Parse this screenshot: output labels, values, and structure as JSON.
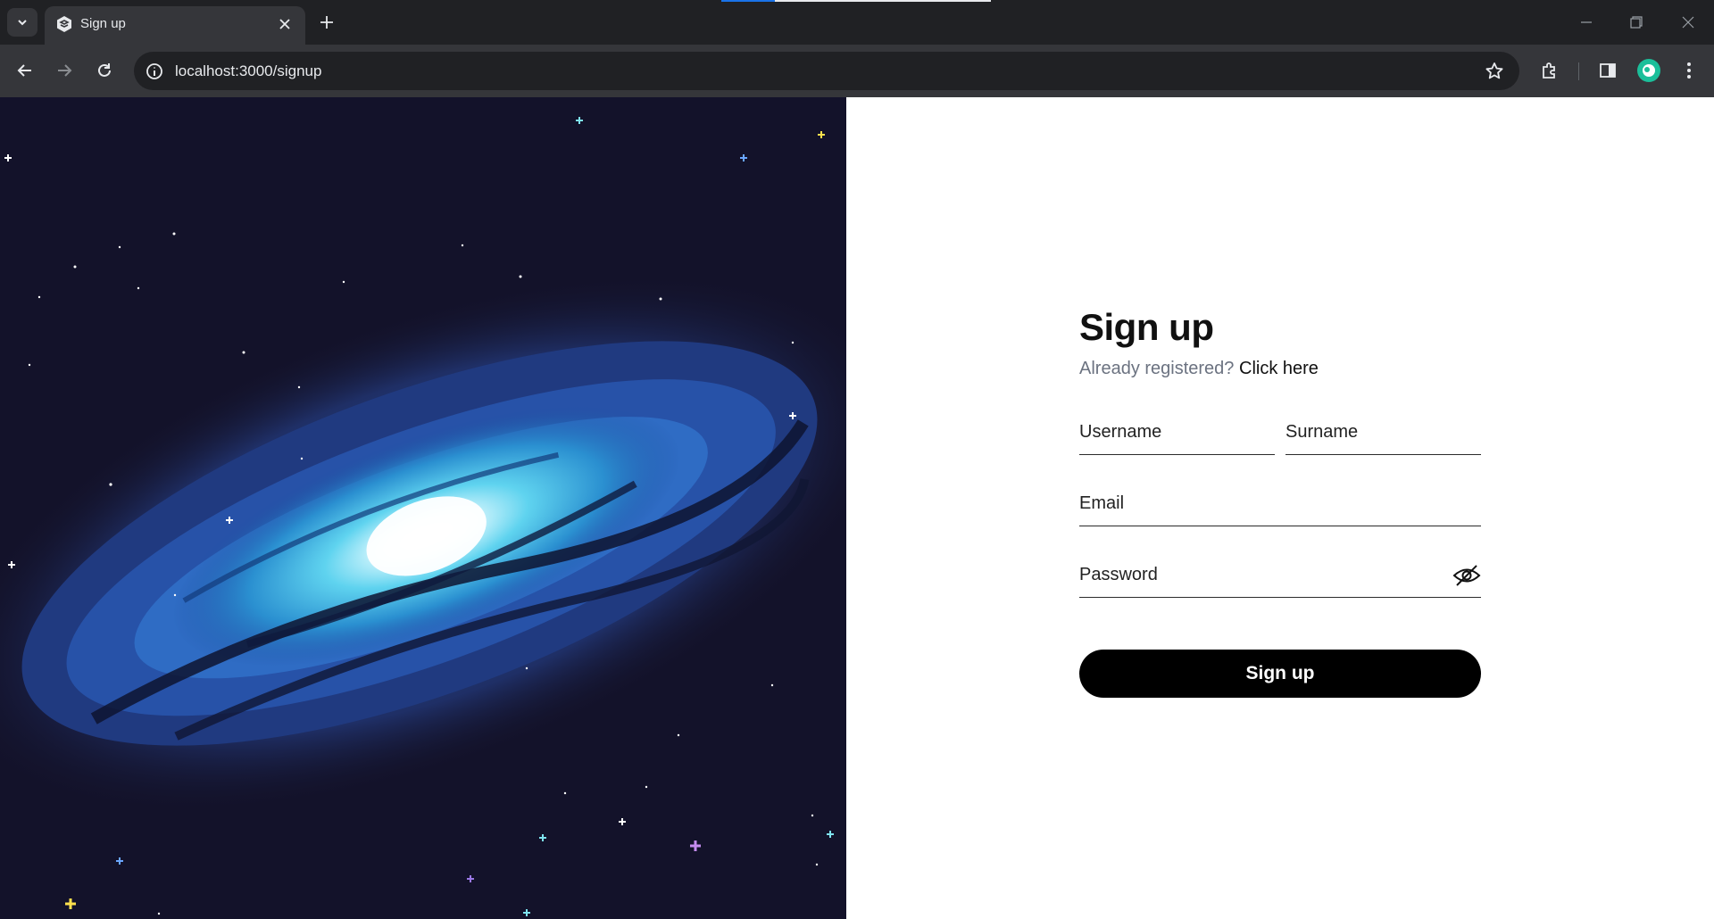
{
  "browser": {
    "tab_title": "Sign up",
    "url": "localhost:3000/signup"
  },
  "signup": {
    "title": "Sign up",
    "already_text": "Already registered?",
    "click_here": "Click here",
    "username_placeholder": "Username",
    "surname_placeholder": "Surname",
    "email_placeholder": "Email",
    "password_placeholder": "Password",
    "submit_label": "Sign up"
  },
  "colors": {
    "chrome_dark": "#202124",
    "chrome_toolbar": "#35363a",
    "space_bg": "#14132a",
    "button_bg": "#000000",
    "link": "#111111",
    "muted": "#6b7280"
  }
}
